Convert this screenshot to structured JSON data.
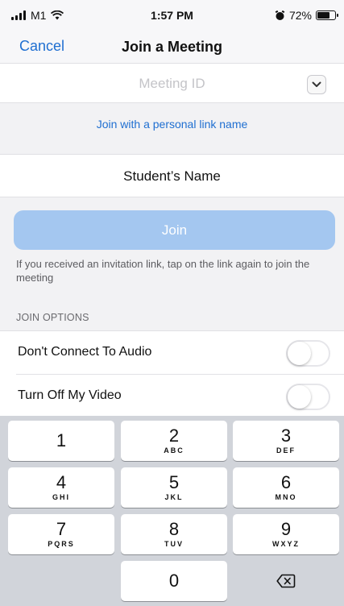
{
  "status_bar": {
    "carrier": "M1",
    "time": "1:57 PM",
    "battery_percent": "72%",
    "battery_level": 0.72
  },
  "nav": {
    "cancel_label": "Cancel",
    "title": "Join a Meeting"
  },
  "meeting_id": {
    "placeholder": "Meeting ID",
    "value": ""
  },
  "personal_link_label": "Join with a personal link name",
  "name_field": {
    "value": "Student’s Name"
  },
  "join_button_label": "Join",
  "join_hint": "If you received an invitation link, tap on the link again to join the meeting",
  "join_options": {
    "header": "JOIN OPTIONS",
    "items": [
      {
        "label": "Don't Connect To Audio",
        "enabled": false
      },
      {
        "label": "Turn Off My Video",
        "enabled": false
      }
    ]
  },
  "keypad": {
    "keys": [
      {
        "digit": "1",
        "letters": ""
      },
      {
        "digit": "2",
        "letters": "ABC"
      },
      {
        "digit": "3",
        "letters": "DEF"
      },
      {
        "digit": "4",
        "letters": "GHI"
      },
      {
        "digit": "5",
        "letters": "JKL"
      },
      {
        "digit": "6",
        "letters": "MNO"
      },
      {
        "digit": "7",
        "letters": "PQRS"
      },
      {
        "digit": "8",
        "letters": "TUV"
      },
      {
        "digit": "9",
        "letters": "WXYZ"
      },
      {
        "digit": "0",
        "letters": ""
      }
    ],
    "delete_icon": "backspace-icon"
  },
  "colors": {
    "accent": "#1f6fd1",
    "join_button": "#a4c7f0",
    "keyboard_bg": "#d1d4da"
  }
}
